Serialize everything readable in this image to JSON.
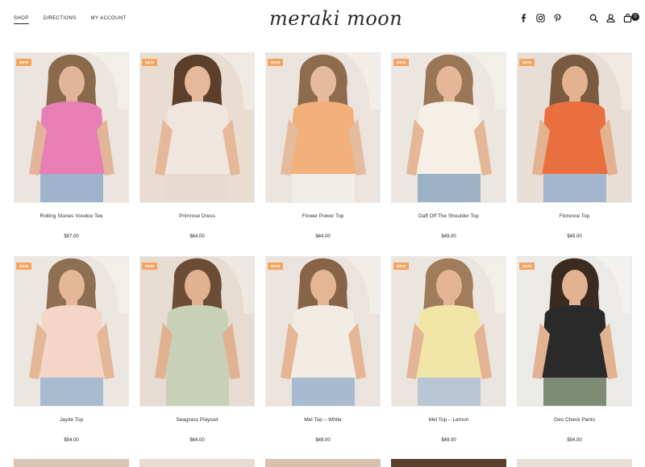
{
  "nav": {
    "items": [
      {
        "label": "SHOP"
      },
      {
        "label": "DIRECTIONS"
      },
      {
        "label": "MY ACCOUNT"
      }
    ]
  },
  "brand": {
    "logo_text": "meraki moon"
  },
  "header_icons": [
    "facebook-icon",
    "instagram-icon",
    "pinterest-icon",
    "search-icon",
    "account-icon",
    "cart-icon"
  ],
  "cart": {
    "count": "0"
  },
  "badge_label": "NEW",
  "colors": {
    "badge": "#f4a460"
  },
  "products": [
    {
      "name": "Rolling Stones Voodoo Tee",
      "price": "$97.00",
      "badge": "NEW",
      "bg": "#ece5df",
      "shirt": "#e77fb4",
      "skin": "#e2b59a",
      "hair": "#8a6a4b",
      "pants": "#9fb4cc"
    },
    {
      "name": "Primrose Dress",
      "price": "$64.00",
      "badge": "NEW",
      "bg": "#e9ddd2",
      "shirt": "#efe6df",
      "skin": "#e4b899",
      "hair": "#5b3f2b",
      "pants": "#e8dad0"
    },
    {
      "name": "Flower Power Top",
      "price": "$44.00",
      "badge": "NEW",
      "bg": "#ebe3dd",
      "shirt": "#f2b07a",
      "skin": "#e5bb9d",
      "hair": "#8e6b4c",
      "pants": "#f1ede8"
    },
    {
      "name": "Daff Off The Shoulder Top",
      "price": "$49.00",
      "badge": "NEW",
      "bg": "#ece6e0",
      "shirt": "#f5efe6",
      "skin": "#e4b797",
      "hair": "#9a7556",
      "pants": "#9cb0c6"
    },
    {
      "name": "Florence Top",
      "price": "$49.00",
      "badge": "NEW",
      "bg": "#e8ded5",
      "shirt": "#ea6f3f",
      "skin": "#e2b291",
      "hair": "#7a5a41",
      "pants": "#a2b6cd"
    },
    {
      "name": "Jayde Top",
      "price": "$54.00",
      "badge": "NEW",
      "bg": "#ece6e1",
      "shirt": "#f3d6c8",
      "skin": "#e4b797",
      "hair": "#8f6f52",
      "pants": "#a9bbd0"
    },
    {
      "name": "Seagrass Playsuit",
      "price": "$64.00",
      "badge": "NEW",
      "bg": "#e6dcd2",
      "shirt": "#c8d1b8",
      "skin": "#e1b291",
      "hair": "#6b4d36",
      "pants": "#c8d1b8"
    },
    {
      "name": "Mel Top – White",
      "price": "$49.00",
      "badge": "NEW",
      "bg": "#ebe4de",
      "shirt": "#f2ece4",
      "skin": "#e4b696",
      "hair": "#876446",
      "pants": "#a7bad0"
    },
    {
      "name": "Mel Top – Lemon",
      "price": "$49.00",
      "badge": "NEW",
      "bg": "#ebe5df",
      "shirt": "#f1e6a8",
      "skin": "#e3b595",
      "hair": "#a07c5b",
      "pants": "#b8c6d6"
    },
    {
      "name": "Geo Check Pants",
      "price": "$54.00",
      "badge": "NEW",
      "bg": "#eceae6",
      "shirt": "#2a2a2a",
      "skin": "#e2b393",
      "hair": "#3a2a20",
      "pants": "#7f8c74"
    }
  ]
}
